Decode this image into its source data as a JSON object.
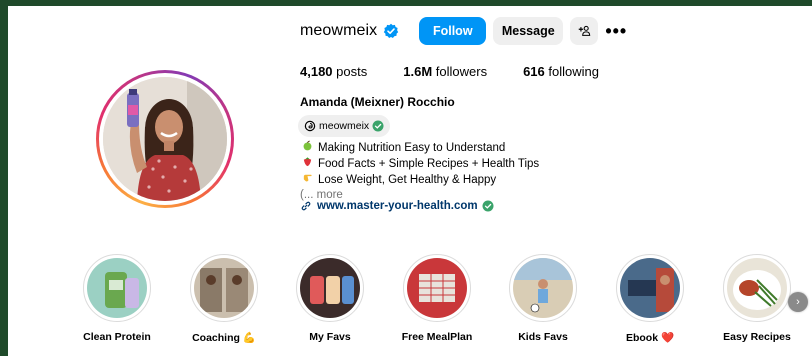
{
  "profile": {
    "username": "meowmeix",
    "full_name": "Amanda (Meixner) Rocchio",
    "threads_handle": "meowmeix"
  },
  "actions": {
    "follow_label": "Follow",
    "message_label": "Message",
    "add_user_label": "+&#9906;",
    "more_label": "•••"
  },
  "stats": {
    "posts_count": "4,180",
    "posts_label": "posts",
    "followers_count": "1.6M",
    "followers_label": "followers",
    "following_count": "616",
    "following_label": "following"
  },
  "bio": {
    "lines": [
      "Making Nutrition Easy to Understand",
      "Food Facts + Simple Recipes + Health Tips",
      "Lose Weight, Get Healthy & Happy"
    ],
    "more_prefix": "(...",
    "more_label": "more",
    "link": "www.master-your-health.com"
  },
  "highlights": [
    {
      "label": "Clean Protein"
    },
    {
      "label": "Coaching 💪"
    },
    {
      "label": "My Favs"
    },
    {
      "label": "Free MealPlan"
    },
    {
      "label": "Kids Favs"
    },
    {
      "label": "Ebook ❤️"
    },
    {
      "label": "Easy Recipes"
    }
  ],
  "highlight_next_label": "›",
  "colors": {
    "follow_button": "#0095f6",
    "secondary_button": "#efefef",
    "link": "#00376b",
    "verified": "#0095f6",
    "threads_check": "#3aa36a",
    "page_frame": "#1f4a2a"
  }
}
